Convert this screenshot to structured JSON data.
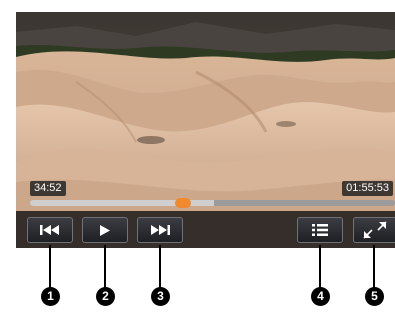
{
  "player": {
    "elapsed_time": "34:52",
    "total_time": "01:55:53",
    "progress": 0.418,
    "buffered": 0.503
  },
  "colors": {
    "progress_thumb": "#f08a2c",
    "controls_bg": "#141416"
  },
  "controls": [
    {
      "name": "previous-chapter",
      "icon": "skip-back-icon"
    },
    {
      "name": "play",
      "icon": "play-icon"
    },
    {
      "name": "next-chapter",
      "icon": "skip-forward-icon"
    },
    {
      "name": "menu",
      "icon": "list-icon"
    },
    {
      "name": "fullscreen",
      "icon": "expand-icon"
    }
  ],
  "callouts": [
    "1",
    "2",
    "3",
    "4",
    "5"
  ]
}
